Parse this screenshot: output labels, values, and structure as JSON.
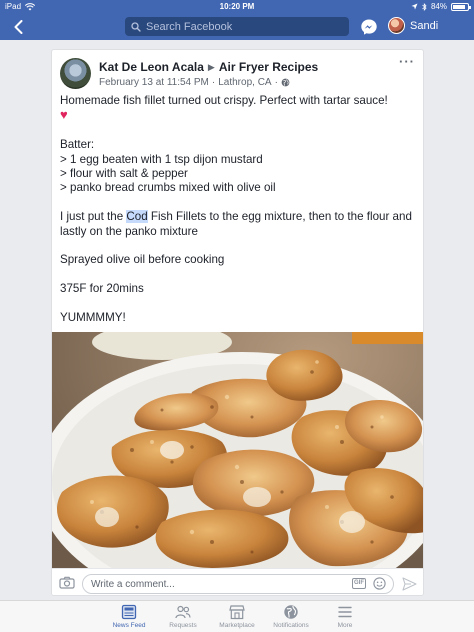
{
  "status_bar": {
    "device": "iPad",
    "time": "10:20 PM",
    "battery_percent_label": "84%",
    "battery_level": 0.84
  },
  "nav": {
    "search_placeholder": "Search Facebook",
    "user_name": "Sandi"
  },
  "post": {
    "author": "Kat De Leon Acala",
    "group": "Air Fryer Recipes",
    "date": "February 13 at 11:54 PM",
    "location": "Lathrop, CA",
    "body": {
      "line1": "Homemade fish fillet turned out crispy. Perfect with tartar sauce!",
      "heart": "♥",
      "batter_title": "Batter:",
      "ingredients": [
        "> 1 egg beaten with 1 tsp dijon mustard",
        "> flour with salt & pepper",
        "> panko bread crumbs mixed with olive oil"
      ],
      "para2_before": "I just put the ",
      "para2_highlight": "Cod",
      "para2_after": " Fish Fillets to the egg mixture, then to the flour and lastly on the panko mixture",
      "line_spray": "Sprayed olive oil before cooking",
      "line_temp": "375F for 20mins",
      "line_yum": "YUMMMMY!"
    }
  },
  "comment": {
    "placeholder": "Write a comment...",
    "gif_label": "GIF"
  },
  "tabs": [
    {
      "label": "News Feed",
      "active": true
    },
    {
      "label": "Requests",
      "active": false
    },
    {
      "label": "Marketplace",
      "active": false
    },
    {
      "label": "Notifications",
      "active": false
    },
    {
      "label": "More",
      "active": false
    }
  ],
  "colors": {
    "brand": "#4267b2",
    "highlight": "#c6dafc",
    "heart": "#e0245e"
  }
}
